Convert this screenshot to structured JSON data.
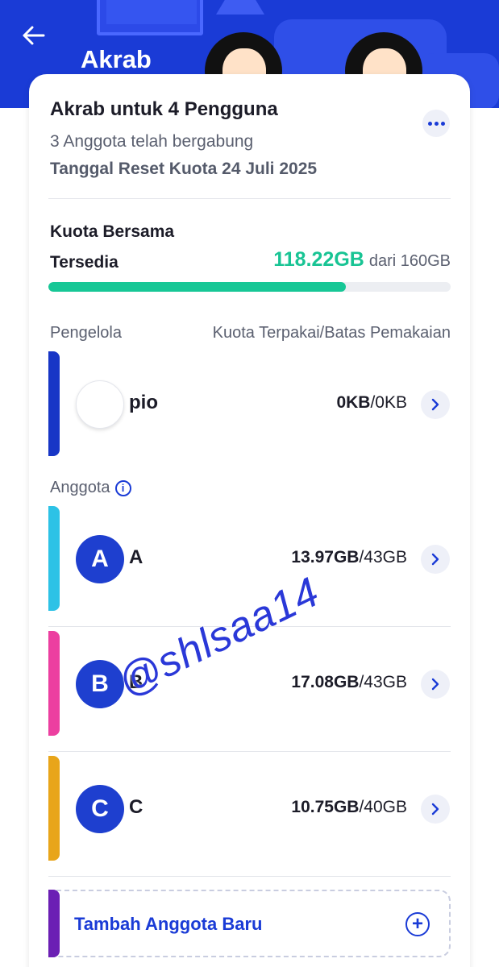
{
  "header": {
    "title": "Akrab",
    "bg_color": "#1a3bd6",
    "back_icon": "arrow-left-icon"
  },
  "plan": {
    "title": "Akrab untuk 4 Pengguna",
    "joined_text": "3 Anggota telah bergabung",
    "reset_text": "Tanggal Reset Kuota 24 Juli 2025",
    "more_icon": "more-horizontal-icon"
  },
  "quota": {
    "label": "Kuota Bersama",
    "available_label": "Tersedia",
    "available_value": "118.22GB",
    "total_text": "dari 160GB",
    "fill_fraction": 0.739,
    "fill_color": "#17c796"
  },
  "manager_section": {
    "col_left": "Pengelola",
    "col_right": "Kuota Terpakai/Batas Pemakaian"
  },
  "manager": {
    "name": "pio",
    "used": "0KB",
    "limit": "/0KB",
    "stripe_color": "#1836c6"
  },
  "members_section": {
    "label": "Anggota",
    "info_icon": "info-icon"
  },
  "members": [
    {
      "initial": "A",
      "name": "A",
      "used": "13.97GB",
      "limit": "/43GB",
      "stripe_color": "#2dc2e6"
    },
    {
      "initial": "B",
      "name": "B",
      "used": "17.08GB",
      "limit": "/43GB",
      "stripe_color": "#ec3fa0"
    },
    {
      "initial": "C",
      "name": "C",
      "used": "10.75GB",
      "limit": "/40GB",
      "stripe_color": "#e8a51a"
    }
  ],
  "add_member": {
    "label": "Tambah Anggota Baru",
    "icon": "plus-circle-icon"
  },
  "watermark": "@shlsaa14"
}
